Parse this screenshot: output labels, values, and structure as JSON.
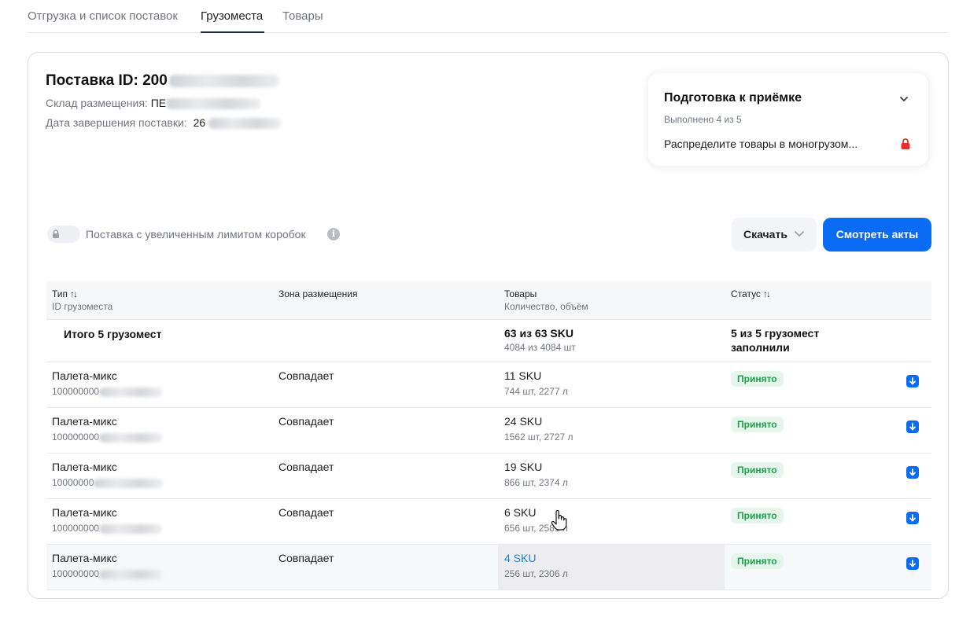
{
  "tabs": [
    {
      "label": "Отгрузка и список поставок",
      "active": false
    },
    {
      "label": "Грузоместа",
      "active": true
    },
    {
      "label": "Товары",
      "active": false
    }
  ],
  "supply": {
    "title": "Поставка ID: 200",
    "warehouse_label": "Склад размещения:",
    "warehouse_value": "ПЕ",
    "end_date_label": "Дата завершения поставки:",
    "end_date_value": "26"
  },
  "prep": {
    "title": "Подготовка к приёмке",
    "progress": "Выполнено 4 из 5",
    "task": "Распределите товары в моногрузом..."
  },
  "toggle": {
    "label": "Поставка с увеличенным лимитом коробок"
  },
  "buttons": {
    "download": "Скачать",
    "view_acts": "Смотреть акты"
  },
  "table": {
    "headers": {
      "type": "Тип",
      "type_sub": "ID грузоместа",
      "zone": "Зона размещения",
      "goods": "Товары",
      "goods_sub": "Количество, объём",
      "status": "Статус"
    },
    "total": {
      "label": "Итого 5 грузомест",
      "sku": "63 из 63 SKU",
      "qty": "4084 из 4084 шт",
      "status_line1": "5 из 5 грузомест",
      "status_line2": "заполнили"
    },
    "rows": [
      {
        "type": "Палета-микс",
        "id": "100000000",
        "zone": "Совпадает",
        "sku": "11 SKU",
        "qty": "744 шт, 2277 л",
        "status": "Принято"
      },
      {
        "type": "Палета-микс",
        "id": "100000000",
        "zone": "Совпадает",
        "sku": "24 SKU",
        "qty": "1562 шт, 2727 л",
        "status": "Принято"
      },
      {
        "type": "Палета-микс",
        "id": "10000000",
        "zone": "Совпадает",
        "sku": "19 SKU",
        "qty": "866 шт, 2374 л",
        "status": "Принято"
      },
      {
        "type": "Палета-микс",
        "id": "100000000",
        "zone": "Совпадает",
        "sku": "6 SKU",
        "qty": "656 шт, 2581 л",
        "status": "Принято"
      },
      {
        "type": "Палета-микс",
        "id": "100000000",
        "zone": "Совпадает",
        "sku": "4 SKU",
        "qty": "256 шт, 2306 л",
        "status": "Принято"
      }
    ]
  },
  "colors": {
    "accent": "#0a6cf5",
    "status_green": "#1d9c4a",
    "link": "#1a82d9",
    "lock_red": "#e5332a"
  },
  "icons": [
    "chevron-down-icon",
    "lock-icon",
    "info-icon",
    "sort-icon",
    "download-icon",
    "hand-cursor-icon"
  ]
}
